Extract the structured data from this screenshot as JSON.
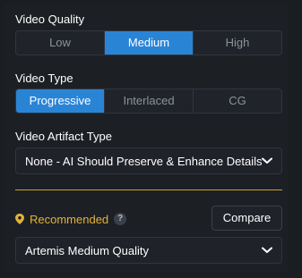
{
  "video_quality": {
    "label": "Video Quality",
    "options": [
      "Low",
      "Medium",
      "High"
    ],
    "selected": "Medium"
  },
  "video_type": {
    "label": "Video Type",
    "options": [
      "Progressive",
      "Interlaced",
      "CG"
    ],
    "selected": "Progressive"
  },
  "artifact_type": {
    "label": "Video Artifact Type",
    "value": "None - AI Should Preserve & Enhance Details"
  },
  "recommended": {
    "label": "Recommended",
    "help": "?",
    "compare_label": "Compare",
    "model_value": "Artemis Medium Quality"
  },
  "colors": {
    "accent": "#2a84d6",
    "recommended": "#e2b33a",
    "divider": "#c9a227",
    "background": "#1c1f24"
  },
  "icons": {
    "chevron": "chevron-down-icon",
    "pin": "location-pin-icon",
    "help": "question-mark-icon"
  }
}
